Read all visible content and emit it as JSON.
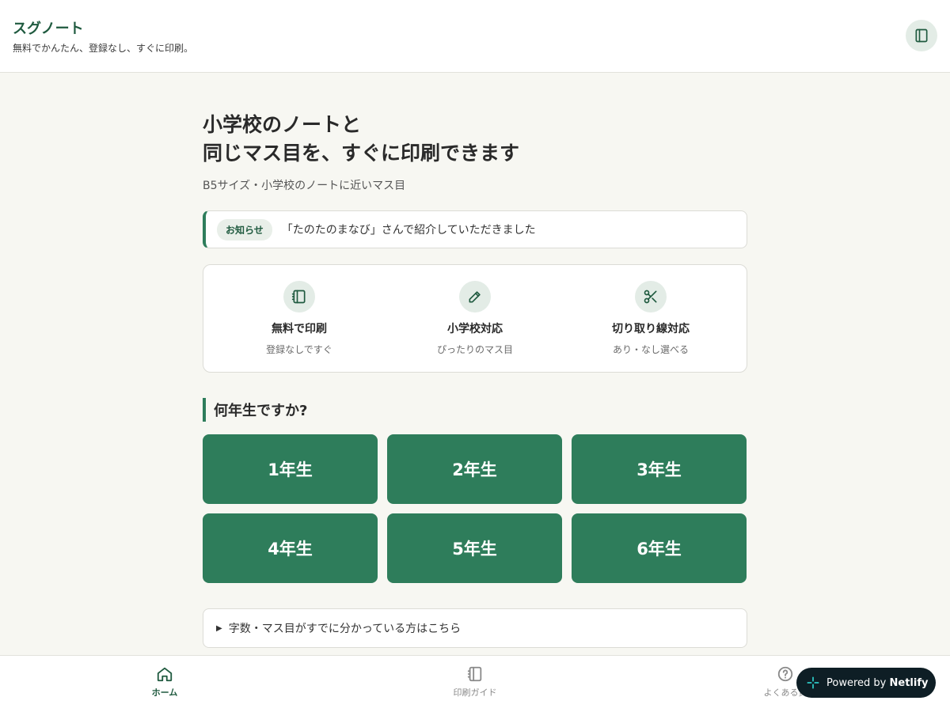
{
  "header": {
    "title": "スグノート",
    "tagline": "無料でかんたん、登録なし、すぐに印刷。",
    "menu_icon": "notebook-icon"
  },
  "hero": {
    "title_line1": "小学校のノートと",
    "title_line2": "同じマス目を、すぐに印刷できます",
    "subtitle": "B5サイズ・小学校のノートに近いマス目"
  },
  "notice": {
    "badge": "お知らせ",
    "text": "「たのたのまなび」さんで紹介していただきました"
  },
  "features": [
    {
      "icon": "notebook-icon",
      "title": "無料で印刷",
      "desc": "登録なしですぐ"
    },
    {
      "icon": "pencil-icon",
      "title": "小学校対応",
      "desc": "ぴったりのマス目"
    },
    {
      "icon": "scissors-icon",
      "title": "切り取り線対応",
      "desc": "あり・なし選べる"
    }
  ],
  "grade_section": {
    "heading": "何年生ですか?",
    "grades": [
      "1年生",
      "2年生",
      "3年生",
      "4年生",
      "5年生",
      "6年生"
    ]
  },
  "details": {
    "label": "字数・マス目がすでに分かっている方はこちら"
  },
  "bottom_nav": {
    "items": [
      {
        "icon": "home-icon",
        "label": "ホーム",
        "active": true
      },
      {
        "icon": "notebook-icon",
        "label": "印刷ガイド",
        "active": false
      },
      {
        "icon": "question-icon",
        "label": "よくある質",
        "active": false
      }
    ]
  },
  "netlify": {
    "prefix": "Powered by",
    "brand": "Netlify"
  },
  "colors": {
    "accent": "#2e7d5b",
    "accent_dark": "#1f5a3f",
    "background": "#f7f7f2"
  }
}
